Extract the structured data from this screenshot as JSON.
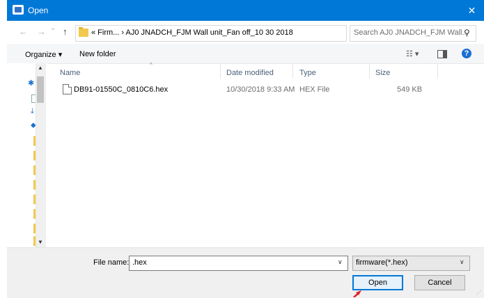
{
  "window": {
    "title": "Open",
    "close_glyph": "✕"
  },
  "nav": {
    "back_glyph": "←",
    "forward_glyph": "→",
    "recent_glyph": "⌄",
    "up_glyph": "↑",
    "address_text": "« Firm... › AJ0 JNADCH_FJM Wall unit_Fan off_10 30 2018",
    "address_drop_glyph": "∨",
    "refresh_glyph": "↻",
    "search_placeholder": "Search AJ0 JNADCH_FJM Wall...",
    "search_glyph": "⚲"
  },
  "toolbar": {
    "organize_label": "Organize ▾",
    "new_folder_label": "New folder",
    "view_glyph": "☷ ▾",
    "help_glyph": "?"
  },
  "columns": {
    "name": "Name",
    "date_modified": "Date modified",
    "type": "Type",
    "size": "Size",
    "sort_glyph": "^"
  },
  "files": [
    {
      "name": "DB91-01550C_0810C6.hex",
      "date_modified": "10/30/2018 9:33 AM",
      "type": "HEX File",
      "size": "549 KB"
    }
  ],
  "bottom": {
    "file_name_label": "File name:",
    "file_name_value": ".hex",
    "file_type_value": "firmware(*.hex)",
    "open_label": "Open",
    "cancel_label": "Cancel"
  },
  "colors": {
    "titlebar": "#0078d7",
    "accent": "#0078d7",
    "folder": "#f2c94c",
    "annotation_arrow": "#e0202a"
  }
}
